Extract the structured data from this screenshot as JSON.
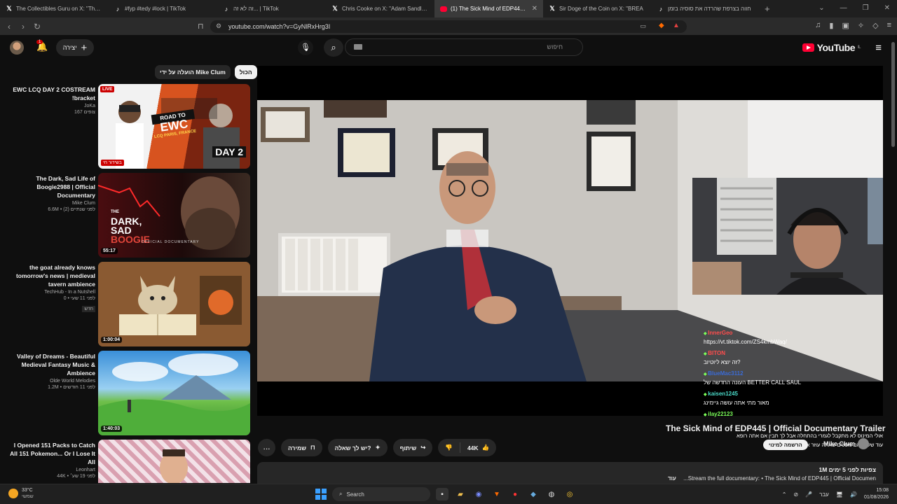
{
  "browser": {
    "tabs": [
      {
        "title": "The Collectibles Guru on X: \"They re",
        "icon": "x-icon"
      },
      {
        "title": "#fyp #tedy #lock | TikTok",
        "icon": "tiktok-icon"
      },
      {
        "title": "זה לא זה... | TikTok",
        "icon": "tiktok-icon"
      },
      {
        "title": "Chris Cooke on X: \"Adam Sandler sha",
        "icon": "x-icon"
      },
      {
        "title": "(1) The Sick Mind of EDP445 | Of",
        "icon": "youtube-icon",
        "active": true
      },
      {
        "title": "Sir Doge of the Coin on X: \"BREA",
        "icon": "x-icon"
      },
      {
        "title": "חווה בצרפת שהרדה את סוסיה בזמן",
        "icon": "tiktok-icon"
      }
    ],
    "url": "youtube.com/watch?v=GyNlRxHrg3I"
  },
  "header": {
    "logo_text": "YouTube",
    "logo_sup": "IL",
    "search_placeholder": "חיפוש",
    "create_label": "יצירה",
    "notification_count": "1"
  },
  "chips": [
    {
      "label": "הכול",
      "selected": true
    },
    {
      "label": "הועלה על ידי Mike Clum",
      "selected": false
    }
  ],
  "recommendations": [
    {
      "title": "EWC LCQ DAY 2 COSTREAM !bracket",
      "channel": "JoKa",
      "meta": "167 צופים",
      "badge": "LIVE",
      "overlay": "בשידור חי",
      "thumb_text": [
        "ROAD TO",
        "EWC",
        "LCQ PARIS, FRANCE",
        "DAY 2"
      ]
    },
    {
      "title": "The Dark, Sad Life of Boogie2988 | Official Documentary",
      "channel": "Mike Clum",
      "meta": "6.6M • לפני שנתיים (2)",
      "duration": "55:17",
      "thumb_text": [
        "THE",
        "DARK,",
        "SAD",
        "LIFE OF",
        "BOOGIE",
        "OFFICIAL DOCUMENTARY"
      ]
    },
    {
      "title": "the goat already knows tomorrow's news | medieval tavern ambience",
      "channel": "TechHub - In a Nutshell",
      "meta": "0 • לפני 11 שעי",
      "tag": "חדש",
      "duration": "1:00:04"
    },
    {
      "title": "Valley of Dreams - Beautiful Medieval Fantasy Music & Ambience",
      "channel": "Olde World Melodies",
      "meta": "1.2M • לפני 11 חודשים",
      "duration": "1:40:03"
    },
    {
      "title": "I Opened 151 Packs to Catch All 151 Pokemon... Or I Lose It All",
      "channel": "Leonhart",
      "meta": "44K • לפני 19 שע׳"
    }
  ],
  "player": {
    "chat": [
      {
        "user": "InnerGeo",
        "msg": "https://vt.tiktok.com/ZS4kmbWaq/",
        "color": "#ff4d4d"
      },
      {
        "user": "BITON",
        "msg": "זה יוצא ליוטיוב?",
        "color": "#ff4d4d"
      },
      {
        "user": "BlueMac3112",
        "msg": "העונה החדשה של BETTER CALL SAUL",
        "color": "#3a6bd6"
      },
      {
        "user": "kaisen1245",
        "msg": "מאור מתי אתה עושה גיימינג",
        "color": "#4ad9c8"
      },
      {
        "user": "ilay22123",
        "msg": "",
        "color": "#7cff5a"
      }
    ],
    "overlay_title": "The Sick Mind of EDP445 | Official Documentary Trailer",
    "overlay_sub_1": "אולי המינוס לא מתקבל לגמרי בהתחלה אבל לך תבין אם אתה רופא",
    "overlay_sub_2": "עוד של...באם מסכים שאתה עוזר אליי לקליניקה",
    "overlay_channel": "Mike Clum",
    "subscribe_label": "הרשמה למינוי"
  },
  "actions": {
    "likes": "44K",
    "share": "שיתוף",
    "ask": "יש לך שאלה?",
    "save": "שמירה",
    "more": "..."
  },
  "description": {
    "views_date": "1M צפיות  לפני 5 ימים",
    "line": "...Stream the full documentary: • The Sick Mind of EDP445 | Official Documen",
    "more": "עוד"
  },
  "taskbar": {
    "temp": "33°C",
    "weather": "שמשי",
    "search": "Search",
    "lang": "עבר",
    "time": "15:08",
    "date": "01/08/2026"
  }
}
